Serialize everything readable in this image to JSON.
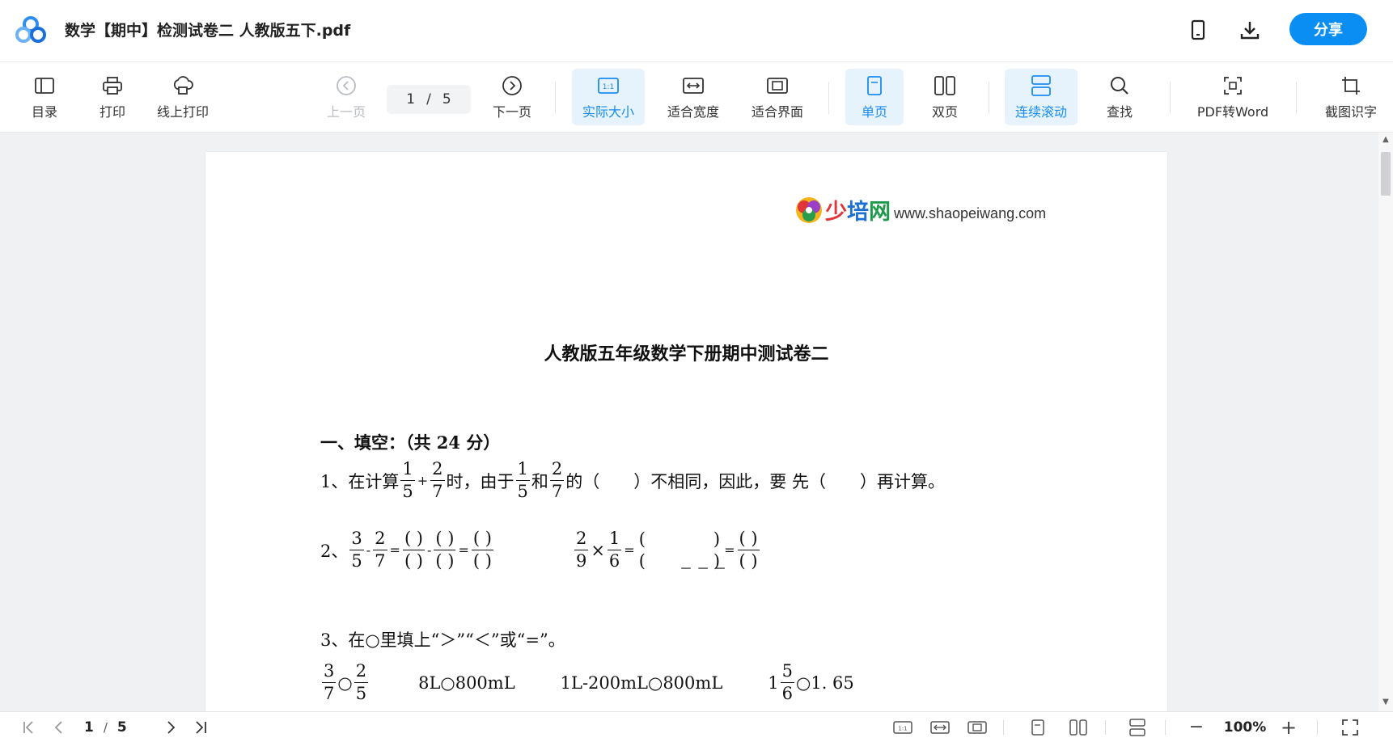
{
  "app": {
    "title": "数学【期中】检测试卷二 人教版五下.pdf",
    "share_label": "分享",
    "icons": [
      "app-logo-icon",
      "mobile-icon",
      "download-icon"
    ]
  },
  "toolbar": {
    "toc": "目录",
    "print": "打印",
    "online_print": "线上打印",
    "prev_page": "上一页",
    "current_page": "1",
    "page_sep": "/",
    "total_pages": "5",
    "next_page": "下一页",
    "actual_size": "实际大小",
    "fit_width": "适合宽度",
    "fit_page": "适合界面",
    "single_page": "单页",
    "double_page": "双页",
    "continuous_scroll": "连续滚动",
    "find": "查找",
    "pdf_to_word": "PDF转Word",
    "screenshot_ocr": "截图识字",
    "accent_color": "#1a8cf0"
  },
  "document": {
    "brand_chars": [
      "少",
      "培",
      "网"
    ],
    "brand_url": "www.shaopeiwang.com",
    "title": "人教版五年级数学下册期中测试卷二",
    "section1": "一、填空：（共 24 分）",
    "q1": {
      "prefix": "1、在计算",
      "f1": [
        "1",
        "5"
      ],
      "plus": "+",
      "f2": [
        "2",
        "7"
      ],
      "mid1": "时，由于",
      "f3": [
        "1",
        "5"
      ],
      "and": "和",
      "f4": [
        "2",
        "7"
      ],
      "suffix": "的（　　）不相同，因此，要 先（　　）再计算。"
    },
    "q2": {
      "prefix": "2、",
      "a1": [
        "3",
        "5"
      ],
      "minus": "-",
      "a2": [
        "2",
        "7"
      ],
      "eq": "=",
      "b1": [
        "( )",
        "( )"
      ],
      "b2": [
        "( )",
        "( )"
      ],
      "b3": [
        "( )",
        "( )"
      ],
      "c1": [
        "2",
        "9"
      ],
      "times": "×",
      "c2": [
        "1",
        "6"
      ],
      "c3_num": "(　　　　)",
      "c3_den": "(　　　　)",
      "c3_dash": "－ － －",
      "c4": [
        "( )",
        "( )"
      ]
    },
    "q3": {
      "text": "3、在○里填上“＞”“＜”或“=”。",
      "f1": [
        "3",
        "7"
      ],
      "circle": "○",
      "f2": [
        "2",
        "5"
      ],
      "item2": "8L○800mL",
      "item3": "1L-200mL○800mL",
      "item4_whole": "1",
      "f4": [
        "5",
        "6"
      ],
      "item4_tail": "○1. 65"
    }
  },
  "bottombar": {
    "current_page": "1",
    "sep": "/",
    "total_pages": "5",
    "zoom": "100%",
    "minus": "−",
    "plus": "+"
  }
}
